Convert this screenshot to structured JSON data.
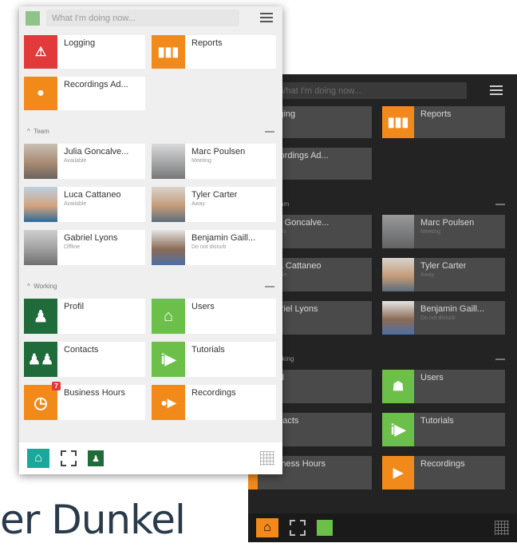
{
  "search": {
    "placeholder": "What I'm doing now..."
  },
  "tiles_top": [
    {
      "label": "Logging"
    },
    {
      "label": "Reports"
    },
    {
      "label": "Recordings Ad..."
    }
  ],
  "section_team": {
    "label": "Team"
  },
  "team": [
    {
      "name": "Julia Goncalve...",
      "status": "Available"
    },
    {
      "name": "Marc Poulsen",
      "status": "Meeting"
    },
    {
      "name": "Luca Cattaneo",
      "status": "Available"
    },
    {
      "name": "Tyler Carter",
      "status": "Away"
    },
    {
      "name": "Gabriel Lyons",
      "status": "Offline"
    },
    {
      "name": "Benjamin Gaill...",
      "status": "Do not disturb"
    }
  ],
  "section_working": {
    "label": "Working"
  },
  "working": [
    {
      "label": "Profil"
    },
    {
      "label": "Users"
    },
    {
      "label": "Contacts"
    },
    {
      "label": "Tutorials"
    },
    {
      "label": "Business Hours"
    },
    {
      "label": "Recordings"
    }
  ],
  "dark": {
    "search_placeholder": "What I'm doing now...",
    "section_team": "am",
    "section_working": "rking",
    "working_badge": "7"
  },
  "badge_count": "7",
  "caption": "er Dunkel",
  "colors": {
    "red": "#e23a3a",
    "orange": "#f28a1b",
    "dark_green": "#1f6b3a",
    "green": "#6cc04a",
    "teal": "#1aa89a"
  }
}
